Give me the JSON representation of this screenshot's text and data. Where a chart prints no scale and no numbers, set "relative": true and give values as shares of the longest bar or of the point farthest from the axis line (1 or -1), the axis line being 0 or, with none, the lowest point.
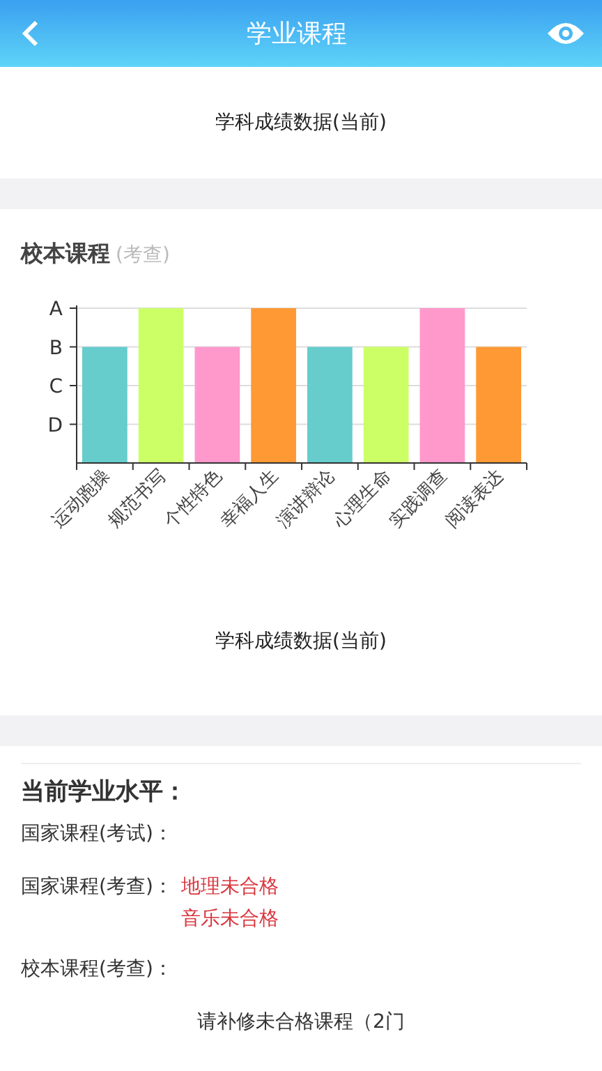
{
  "header": {
    "title": "学业课程"
  },
  "top_section": {
    "caption": "学科成绩数据(当前)"
  },
  "school_courses": {
    "title": "校本课程",
    "subtitle": "(考查)",
    "caption": "学科成绩数据(当前)",
    "chart_data": {
      "type": "bar",
      "categories": [
        "运动跑操",
        "规范书写",
        "个性特色",
        "幸福人生",
        "演讲辩论",
        "心理生命",
        "实践调查",
        "阅读表达"
      ],
      "series": [
        {
          "values": [
            0.75,
            1,
            0.75,
            1,
            0.75,
            0.75,
            1,
            0.75
          ]
        }
      ],
      "relative": true
    },
    "grade_levels": [
      "A",
      "B",
      "C",
      "D"
    ]
  },
  "level": {
    "title": "当前学业水平：",
    "rows": [
      {
        "label": "国家课程(考试)：",
        "values": []
      },
      {
        "label": "国家课程(考查)：",
        "values": [
          "地理未合格",
          "音乐未合格"
        ]
      },
      {
        "label": "校本课程(考查)：",
        "values": []
      }
    ],
    "note": "请补修未合格课程（2门"
  }
}
